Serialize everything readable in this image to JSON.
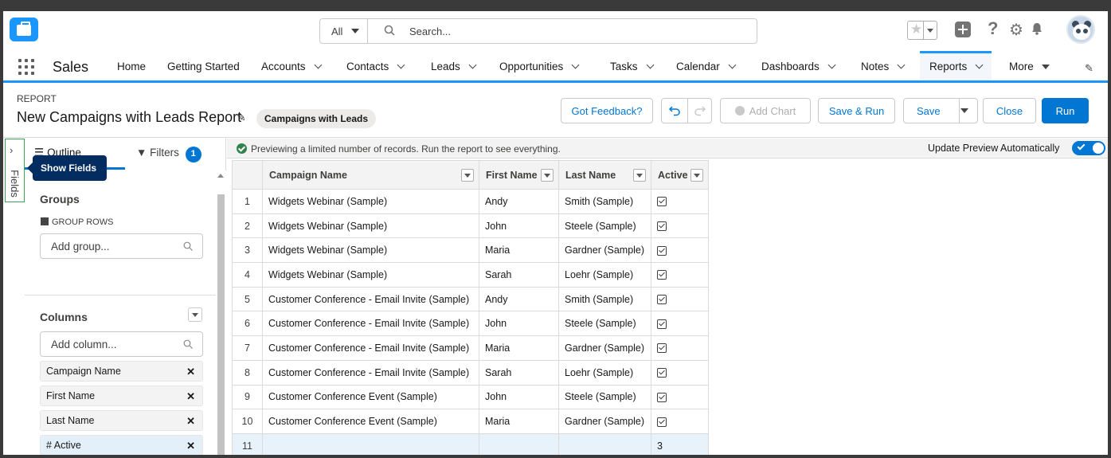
{
  "header": {
    "search": {
      "scope": "All",
      "placeholder": "Search..."
    }
  },
  "nav": {
    "app_name": "Sales",
    "items": [
      {
        "label": "Home"
      },
      {
        "label": "Getting Started"
      },
      {
        "label": "Accounts"
      },
      {
        "label": "Contacts"
      },
      {
        "label": "Leads"
      },
      {
        "label": "Opportunities"
      },
      {
        "label": "Tasks"
      },
      {
        "label": "Calendar"
      },
      {
        "label": "Dashboards"
      },
      {
        "label": "Notes"
      },
      {
        "label": "Reports"
      },
      {
        "label": "More"
      }
    ]
  },
  "report": {
    "label": "REPORT",
    "title": "New Campaigns with Leads Report",
    "type_pill": "Campaigns with Leads",
    "buttons": {
      "feedback": "Got Feedback?",
      "add_chart": "Add Chart",
      "save_run": "Save & Run",
      "save": "Save",
      "close": "Close",
      "run": "Run"
    }
  },
  "left_panel": {
    "fields_rail": "Fields",
    "tooltip": "Show Fields",
    "tab_outline": "Outline",
    "tab_filters": "Filters",
    "filters_count": "1",
    "groups_title": "Groups",
    "group_rows": "GROUP ROWS",
    "add_group_placeholder": "Add group...",
    "columns_title": "Columns",
    "add_column_placeholder": "Add column...",
    "columns": [
      {
        "label": "Campaign Name"
      },
      {
        "label": "First Name"
      },
      {
        "label": "Last Name"
      },
      {
        "label": "# Active"
      }
    ]
  },
  "preview": {
    "notice": "Previewing a limited number of records. Run the report to see everything.",
    "auto_update_label": "Update Preview Automatically",
    "columns": [
      "Campaign Name",
      "First Name",
      "Last Name",
      "Active"
    ],
    "rows": [
      {
        "n": "1",
        "campaign": "Widgets Webinar (Sample)",
        "first": "Andy",
        "last": "Smith (Sample)"
      },
      {
        "n": "2",
        "campaign": "Widgets Webinar (Sample)",
        "first": "John",
        "last": "Steele (Sample)"
      },
      {
        "n": "3",
        "campaign": "Widgets Webinar (Sample)",
        "first": "Maria",
        "last": "Gardner (Sample)"
      },
      {
        "n": "4",
        "campaign": "Widgets Webinar (Sample)",
        "first": "Sarah",
        "last": "Loehr (Sample)"
      },
      {
        "n": "5",
        "campaign": "Customer Conference - Email Invite (Sample)",
        "first": "Andy",
        "last": "Smith (Sample)"
      },
      {
        "n": "6",
        "campaign": "Customer Conference - Email Invite (Sample)",
        "first": "John",
        "last": "Steele (Sample)"
      },
      {
        "n": "7",
        "campaign": "Customer Conference - Email Invite (Sample)",
        "first": "Maria",
        "last": "Gardner (Sample)"
      },
      {
        "n": "8",
        "campaign": "Customer Conference - Email Invite (Sample)",
        "first": "Sarah",
        "last": "Loehr (Sample)"
      },
      {
        "n": "9",
        "campaign": "Customer Conference Event (Sample)",
        "first": "John",
        "last": "Steele (Sample)"
      },
      {
        "n": "10",
        "campaign": "Customer Conference Event (Sample)",
        "first": "Maria",
        "last": "Gardner (Sample)"
      }
    ],
    "total_row": {
      "n": "11",
      "active_total": "3"
    }
  },
  "colors": {
    "brand": "#0176d3",
    "accent": "#1b96ff",
    "success": "#2e844a"
  }
}
